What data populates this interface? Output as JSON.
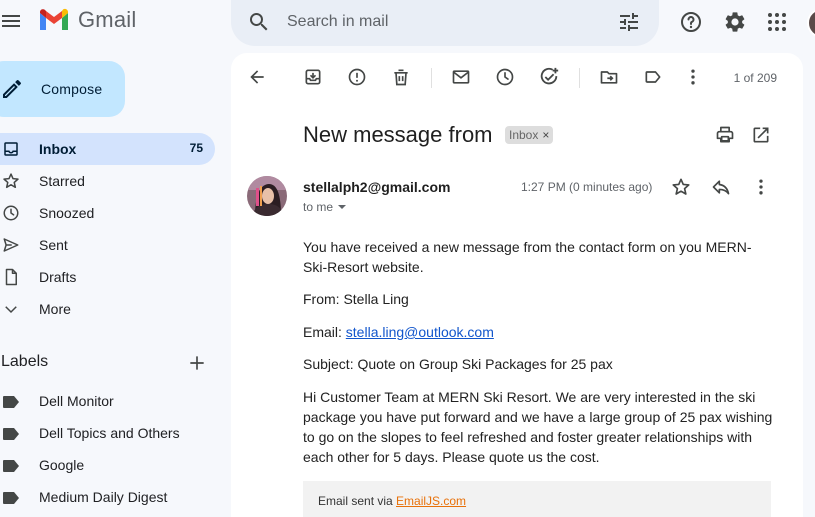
{
  "app": {
    "name": "Gmail",
    "brand_colors": [
      "#ea4335",
      "#4285f4",
      "#34a853",
      "#fbbc04",
      "#c5221f"
    ]
  },
  "search": {
    "placeholder": "Search in mail"
  },
  "compose": {
    "label": "Compose"
  },
  "nav": [
    {
      "label": "Inbox",
      "count": "75",
      "icon": "inbox-icon",
      "active": true
    },
    {
      "label": "Starred",
      "icon": "star-icon"
    },
    {
      "label": "Snoozed",
      "icon": "clock-icon"
    },
    {
      "label": "Sent",
      "icon": "send-icon"
    },
    {
      "label": "Drafts",
      "icon": "draft-icon"
    },
    {
      "label": "More",
      "icon": "chevron-down-icon"
    }
  ],
  "labels": {
    "heading": "Labels",
    "items": [
      "Dell Monitor",
      "Dell Topics and Others",
      "Google",
      "Medium Daily Digest"
    ]
  },
  "toolbar": {
    "icons": [
      "back-arrow-icon",
      "archive-icon",
      "report-spam-icon",
      "delete-icon",
      "mark-unread-icon",
      "snooze-icon",
      "add-task-icon",
      "move-to-icon",
      "label-icon",
      "more-vert-icon"
    ],
    "page_count": "1 of 209"
  },
  "message": {
    "subject": "New message from",
    "chip": "Inbox",
    "chip_close": "×",
    "sender": "stellalph2@gmail.com",
    "to": "to me",
    "time": "1:27 PM (0 minutes ago)",
    "body": {
      "intro": "You have received a new message from the contact form on you MERN-Ski-Resort website.",
      "from": "From: Stella Ling",
      "email_label": "Email: ",
      "email_link": "stella.ling@outlook.com",
      "subject_line": "Subject: Quote on Group Ski Packages for 25 pax",
      "paragraph": "Hi Customer Team at MERN Ski Resort. We are very interested in the ski package you have put forward and we have a large group of 25 pax wishing to go on the slopes to feel refreshed and foster greater relationships with each other for 5 days. Please quote us the cost."
    },
    "footer": {
      "text": "Email sent via ",
      "link": "EmailJS.com"
    }
  }
}
